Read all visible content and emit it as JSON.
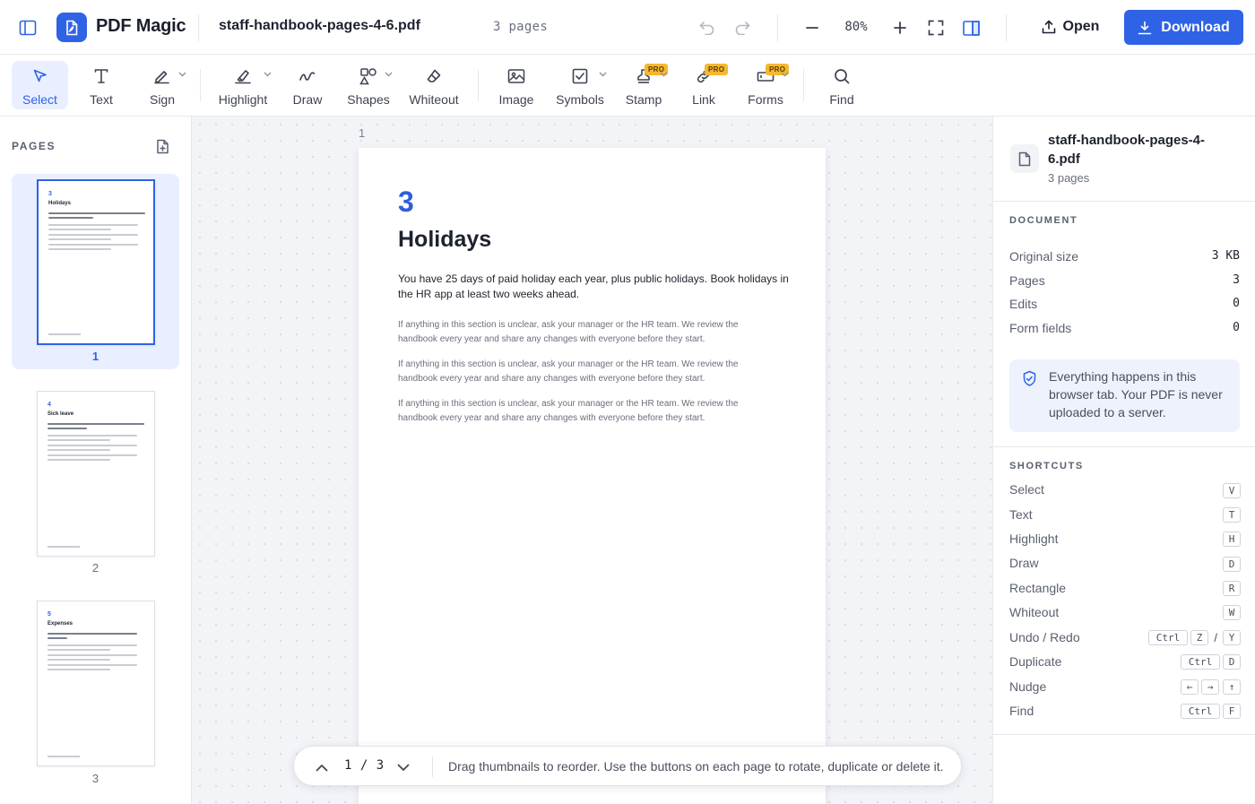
{
  "header": {
    "brand": "PDF Magic",
    "file_name": "staff-handbook-pages-4-6.pdf",
    "page_count": "3  pages",
    "zoom": "80%",
    "open_label": "Open",
    "download_label": "Download",
    "accent_color": "#2f63e6"
  },
  "toolbar": {
    "tools": [
      {
        "label": "Select",
        "icon": "pointer-icon",
        "active": true
      },
      {
        "label": "Text",
        "icon": "text-icon"
      },
      {
        "label": "Sign",
        "icon": "pen-icon",
        "dropdown": true
      },
      {
        "label": "Highlight",
        "icon": "highlighter-icon",
        "dropdown": true
      },
      {
        "label": "Draw",
        "icon": "squiggle-icon"
      },
      {
        "label": "Shapes",
        "icon": "shapes-icon",
        "dropdown": true
      },
      {
        "label": "Whiteout",
        "icon": "eraser-icon"
      },
      {
        "label": "Image",
        "icon": "image-icon"
      },
      {
        "label": "Symbols",
        "icon": "checkbox-icon",
        "dropdown": true
      },
      {
        "label": "Stamp",
        "icon": "stamp-icon",
        "badge": "PRO",
        "dropdown": true
      },
      {
        "label": "Link",
        "icon": "link-icon",
        "badge": "PRO"
      },
      {
        "label": "Forms",
        "icon": "form-icon",
        "badge": "PRO",
        "dropdown": true
      },
      {
        "label": "Find",
        "icon": "search-icon"
      }
    ]
  },
  "pages_panel": {
    "heading": "PAGES",
    "thumbnails": [
      {
        "label": "1",
        "num": "3",
        "title": "Holidays",
        "selected": true
      },
      {
        "label": "2",
        "num": "4",
        "title": "Sick leave"
      },
      {
        "label": "3",
        "num": "5",
        "title": "Expenses"
      }
    ]
  },
  "canvas": {
    "page_index": "1",
    "page": {
      "number": "3",
      "title": "Holidays",
      "lead": "You have 25 days of paid holiday each year, plus public holidays. Book holidays in the HR app at least two weeks ahead.",
      "paragraphs": [
        "If anything in this section is unclear, ask your manager or the HR team. We review the handbook every year and share any changes with everyone before they start.",
        "If anything in this section is unclear, ask your manager or the HR team. We review the handbook every year and share any changes with everyone before they start.",
        "If anything in this section is unclear, ask your manager or the HR team. We review the handbook every year and share any changes with everyone before they start."
      ]
    },
    "pager": {
      "position": "1 / 3",
      "hint": "Drag thumbnails to reorder. Use the buttons on each page to rotate, duplicate or delete it."
    }
  },
  "info_panel": {
    "file_name": "staff-handbook-pages-4-6.pdf",
    "file_pages": "3 pages",
    "document_heading": "DOCUMENT",
    "stats": [
      {
        "label": "Original size",
        "value": "3 KB"
      },
      {
        "label": "Pages",
        "value": "3"
      },
      {
        "label": "Edits",
        "value": "0"
      },
      {
        "label": "Form fields",
        "value": "0"
      }
    ],
    "privacy_note": "Everything happens in this browser tab. Your PDF is never uploaded to a server.",
    "shortcuts_heading": "SHORTCUTS",
    "shortcuts": [
      {
        "label": "Select",
        "keys": [
          "V"
        ]
      },
      {
        "label": "Text",
        "keys": [
          "T"
        ]
      },
      {
        "label": "Highlight",
        "keys": [
          "H"
        ]
      },
      {
        "label": "Draw",
        "keys": [
          "D"
        ]
      },
      {
        "label": "Rectangle",
        "keys": [
          "R"
        ]
      },
      {
        "label": "Whiteout",
        "keys": [
          "W"
        ]
      },
      {
        "label": "Undo / Redo",
        "keys": [
          "Ctrl",
          "Z",
          "/",
          "Y"
        ]
      },
      {
        "label": "Duplicate",
        "keys": [
          "Ctrl",
          "D"
        ]
      },
      {
        "label": "Nudge",
        "keys": [
          "←",
          "→",
          "↑"
        ]
      },
      {
        "label": "Find",
        "keys": [
          "Ctrl",
          "F"
        ]
      }
    ]
  }
}
